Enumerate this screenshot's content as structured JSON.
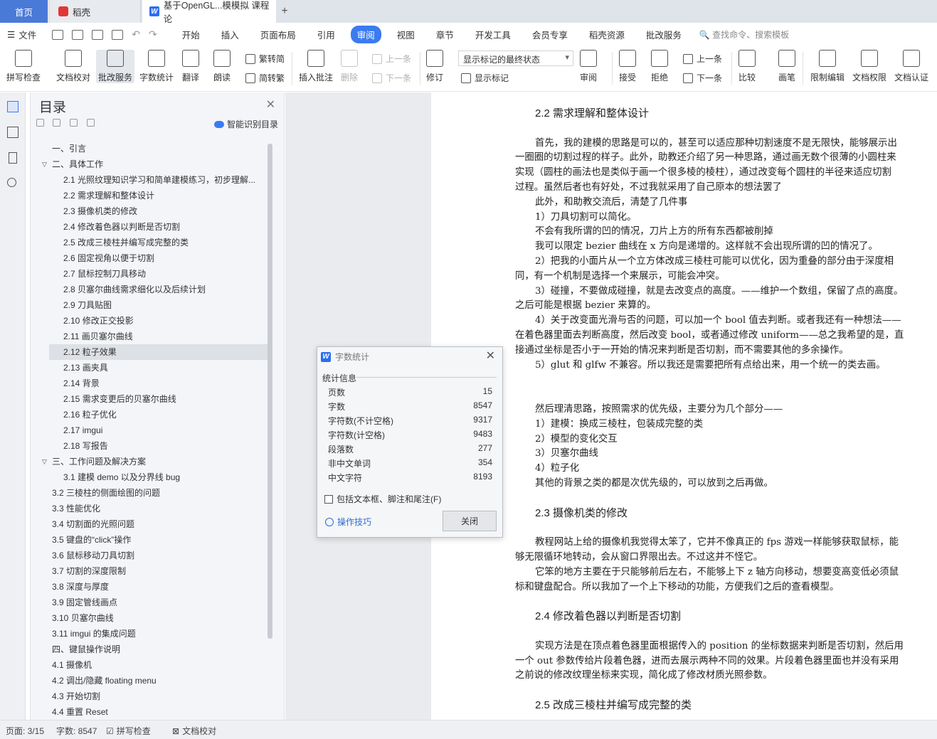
{
  "tabs": {
    "home": "首页",
    "daoke": "稻壳",
    "doc": "基于OpenGL...模模拟 课程论",
    "add": "+"
  },
  "menu": {
    "file": "文件",
    "tabs": [
      "开始",
      "插入",
      "页面布局",
      "引用",
      "审阅",
      "视图",
      "章节",
      "开发工具",
      "会员专享",
      "稻壳资源",
      "批改服务"
    ],
    "active": "审阅",
    "search": "查找命令、搜索模板"
  },
  "ribbon": {
    "spell": "拼写检查",
    "proof": "文档校对",
    "grading": "批改服务",
    "count": "字数统计",
    "translate": "翻译",
    "read": "朗读",
    "trad": "繁转简",
    "simp": "简转繁",
    "insert_comment": "插入批注",
    "delete": "删除",
    "prev": "上一条",
    "next": "下一条",
    "revise": "修订",
    "markup_state": "显示标记的最终状态",
    "show_markup": "显示标记",
    "review": "审阅",
    "accept": "接受",
    "reject": "拒绝",
    "prev2": "上一条",
    "next2": "下一条",
    "compare": "比较",
    "pen": "画笔",
    "restrict": "限制编辑",
    "rights": "文档权限",
    "cert": "文档认证"
  },
  "toc": {
    "title": "目录",
    "smart": "智能识别目录",
    "items": [
      {
        "t": "一、引言",
        "lv": 1
      },
      {
        "t": "二、具体工作",
        "lv": 1,
        "car": "down"
      },
      {
        "t": "2.1 光照纹理知识学习和简单建模练习，初步理解...",
        "lv": 2
      },
      {
        "t": "2.2 需求理解和整体设计",
        "lv": 2
      },
      {
        "t": "2.3 摄像机类的修改",
        "lv": 2
      },
      {
        "t": "2.4 修改着色器以判断是否切割",
        "lv": 2
      },
      {
        "t": "2.5 改成三棱柱并编写成完整的类",
        "lv": 2
      },
      {
        "t": "2.6 固定视角以便于切割",
        "lv": 2
      },
      {
        "t": "2.7 鼠标控制刀具移动",
        "lv": 2
      },
      {
        "t": "2.8 贝塞尔曲线需求细化以及后续计划",
        "lv": 2
      },
      {
        "t": "2.9 刀具贴图",
        "lv": 2
      },
      {
        "t": "2.10 修改正交投影",
        "lv": 2
      },
      {
        "t": "2.11 画贝塞尔曲线",
        "lv": 2
      },
      {
        "t": "2.12 粒子效果",
        "lv": 2,
        "sel": true
      },
      {
        "t": "2.13 画夹具",
        "lv": 2
      },
      {
        "t": "2.14 背景",
        "lv": 2
      },
      {
        "t": "2.15 需求变更后的贝塞尔曲线",
        "lv": 2
      },
      {
        "t": "2.16 粒子优化",
        "lv": 2
      },
      {
        "t": "2.17 imgui",
        "lv": 2
      },
      {
        "t": "2.18 写报告",
        "lv": 2
      },
      {
        "t": "三、工作问题及解决方案",
        "lv": 1,
        "car": "down"
      },
      {
        "t": "3.1 建模 demo 以及分界线 bug",
        "lv": 2
      },
      {
        "t": "3.2 三棱柱的侧面绘图的问题",
        "lv": 1
      },
      {
        "t": "3.3 性能优化",
        "lv": 1
      },
      {
        "t": "3.4 切割面的光照问题",
        "lv": 1
      },
      {
        "t": "3.5 键盘的“click”操作",
        "lv": 1
      },
      {
        "t": "3.6 鼠标移动刀具切割",
        "lv": 1
      },
      {
        "t": "3.7 切割的深度限制",
        "lv": 1
      },
      {
        "t": "3.8 深度与厚度",
        "lv": 1
      },
      {
        "t": "3.9 固定管线画点",
        "lv": 1
      },
      {
        "t": "3.10 贝塞尔曲线",
        "lv": 1
      },
      {
        "t": "3.11 imgui 的集成问题",
        "lv": 1
      },
      {
        "t": "四、键鼠操作说明",
        "lv": 1
      },
      {
        "t": "4.1 摄像机",
        "lv": 1
      },
      {
        "t": "4.2 调出/隐藏 floating menu",
        "lv": 1
      },
      {
        "t": "4.3 开始切割",
        "lv": 1
      },
      {
        "t": "4.4 重置 Reset",
        "lv": 1
      }
    ]
  },
  "doc": {
    "lines": [
      {
        "t": "2.2  需求理解和整体设计",
        "h": true,
        "i": 1
      },
      {
        "t": "",
        "i": 0
      },
      {
        "t": "首先，我的建模的思路是可以的，甚至可以适应那种切割速度不是无限快，能够展示出",
        "i": 1
      },
      {
        "t": "一圈圈的切割过程的样子。此外，助教还介绍了另一种思路，通过画无数个很薄的小圆柱来",
        "i": 0
      },
      {
        "t": "实现（圆柱的画法也是类似于画一个很多棱的棱柱），通过改变每个圆柱的半径来适应切割",
        "i": 0
      },
      {
        "t": "过程。虽然后者也有好处，不过我就采用了自己原本的想法罢了",
        "i": 0
      },
      {
        "t": "此外，和助教交流后，清楚了几件事",
        "i": 1
      },
      {
        "t": "1）刀具切割可以简化。",
        "i": 1
      },
      {
        "t": "不会有我所谓的凹的情况，刀片上方的所有东西都被削掉",
        "i": 1
      },
      {
        "t": "我可以限定 bezier 曲线在 x 方向是递增的。这样就不会出现所谓的凹的情况了。",
        "i": 1
      },
      {
        "t": "2）把我的小面片从一个立方体改成三棱柱可能可以优化，因为重叠的部分由于深度相",
        "i": 1
      },
      {
        "t": "同，有一个机制是选择一个来展示，可能会冲突。",
        "i": 0
      },
      {
        "t": "3）碰撞，不要做成碰撞，就是去改变点的高度。——维护一个数组，保留了点的高度。",
        "i": 1
      },
      {
        "t": "之后可能是根据 bezier 来算的。",
        "i": 0
      },
      {
        "t": "4）关于改变面光滑与否的问题，可以加一个 bool 值去判断。或者我还有一种想法——",
        "i": 1
      },
      {
        "t": "在着色器里面去判断高度，然后改变 bool，或者通过修改 uniform——总之我希望的是，直",
        "i": 0
      },
      {
        "t": "接通过坐标是否小于一开始的情况来判断是否切割，而不需要其他的多余操作。",
        "i": 0
      },
      {
        "t": "5）glut 和 glfw 不兼容。所以我还是需要把所有点给出来，用一个统一的类去画。",
        "i": 1
      },
      {
        "t": "",
        "i": 0
      },
      {
        "t": "",
        "i": 0
      },
      {
        "t": "然后理清思路，按照需求的优先级，主要分为几个部分——",
        "i": 1
      },
      {
        "t": "1）建模：换成三棱柱，包装成完整的类",
        "i": 1
      },
      {
        "t": "2）模型的变化交互",
        "i": 1
      },
      {
        "t": "3）贝塞尔曲线",
        "i": 1
      },
      {
        "t": "4）粒子化",
        "i": 1
      },
      {
        "t": "其他的背景之类的都是次优先级的，可以放到之后再做。",
        "i": 1
      },
      {
        "t": "",
        "i": 0
      },
      {
        "t": "2.3  摄像机类的修改",
        "h": true,
        "i": 1
      },
      {
        "t": "",
        "i": 0
      },
      {
        "t": "教程网站上给的摄像机我觉得太笨了，它并不像真正的 fps 游戏一样能够获取鼠标，能",
        "i": 1
      },
      {
        "t": "够无限循环地转动，会从窗口界限出去。不过这并不怪它。",
        "i": 0
      },
      {
        "t": "它笨的地方主要在于只能够前后左右，不能够上下 z 轴方向移动，想要变高变低必须鼠",
        "i": 1
      },
      {
        "t": "标和键盘配合。所以我加了一个上下移动的功能，方便我们之后的查看模型。",
        "i": 0
      },
      {
        "t": "",
        "i": 0
      },
      {
        "t": "2.4  修改着色器以判断是否切割",
        "h": true,
        "i": 1
      },
      {
        "t": "",
        "i": 0
      },
      {
        "t": "实现方法是在顶点着色器里面根据传入的 position 的坐标数据来判断是否切割，然后用",
        "i": 1
      },
      {
        "t": "一个 out 参数传给片段着色器，进而去展示两种不同的效果。片段着色器里面也并没有采用",
        "i": 0
      },
      {
        "t": "之前说的修改纹理坐标来实现，简化成了修改材质光照参数。",
        "i": 0
      },
      {
        "t": "",
        "i": 0
      },
      {
        "t": "2.5  改成三棱柱并编写成完整的类",
        "h": true,
        "i": 1
      }
    ]
  },
  "dialog": {
    "title": "字数统计",
    "section": "统计信息",
    "rows": [
      {
        "k": "页数",
        "v": "15"
      },
      {
        "k": "字数",
        "v": "8547"
      },
      {
        "k": "字符数(不计空格)",
        "v": "9317"
      },
      {
        "k": "字符数(计空格)",
        "v": "9483"
      },
      {
        "k": "段落数",
        "v": "277"
      },
      {
        "k": "非中文单词",
        "v": "354"
      },
      {
        "k": "中文字符",
        "v": "8193"
      }
    ],
    "checkbox": "包括文本框、脚注和尾注(F)",
    "tips": "操作技巧",
    "close": "关闭"
  },
  "status": {
    "page": "页面: 3/15",
    "words": "字数: 8547",
    "spell": "拼写检查",
    "proof": "文档校对"
  }
}
